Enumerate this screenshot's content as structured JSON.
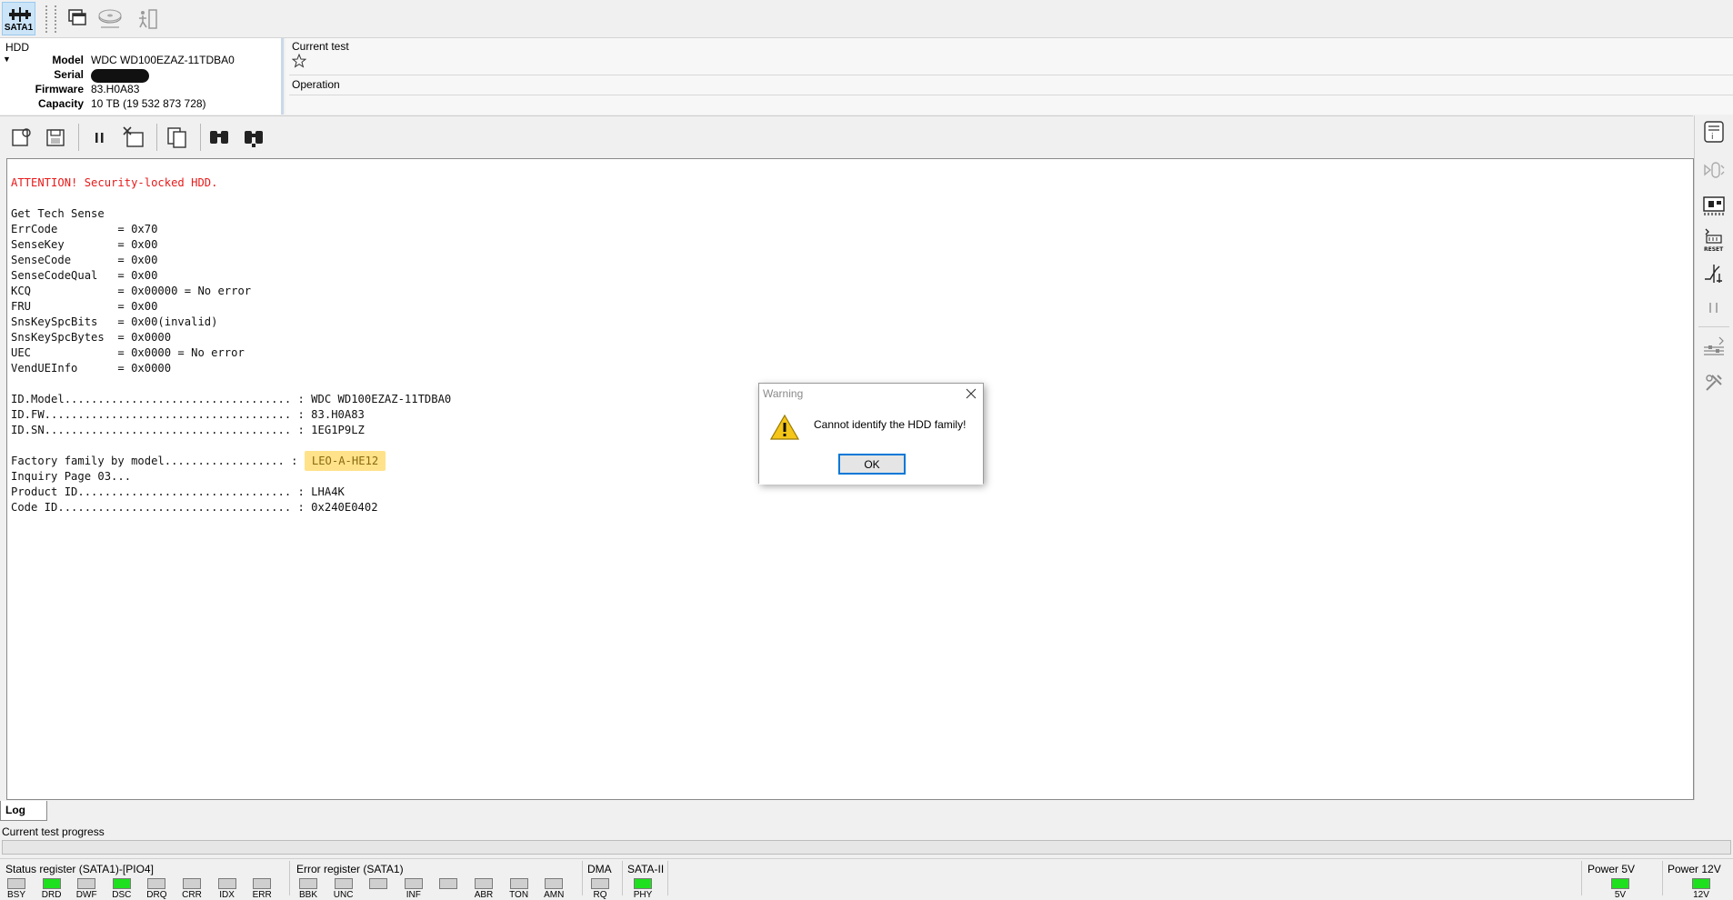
{
  "toolbar": {
    "port_label": "SATA1"
  },
  "hdd": {
    "section_title": "HDD",
    "model_label": "Model",
    "model": "WDC WD100EZAZ-11TDBA0",
    "serial_label": "Serial",
    "firmware_label": "Firmware",
    "firmware": "83.H0A83",
    "capacity_label": "Capacity",
    "capacity": "10 TB (19 532 873 728)"
  },
  "test": {
    "current_test_label": "Current test",
    "operation_label": "Operation"
  },
  "log": {
    "lines": [
      "ATTENTION! Security-locked HDD.",
      "",
      "Get Tech Sense",
      "ErrCode         = 0x70",
      "SenseKey        = 0x00",
      "SenseCode       = 0x00",
      "SenseCodeQual   = 0x00",
      "KCQ             = 0x00000 = No error",
      "FRU             = 0x00",
      "SnsKeySpcBits   = 0x00(invalid)",
      "SnsKeySpcBytes  = 0x0000",
      "UEC             = 0x0000 = No error",
      "VendUEInfo      = 0x0000",
      "",
      "ID.Model.................................. : WDC WD100EZAZ-11TDBA0",
      "ID.FW..................................... : 83.H0A83",
      "ID.SN..................................... : 1EG1P9LZ",
      "",
      "Factory family by model.................. : ",
      "Inquiry Page 03...",
      "Product ID................................ : LHA4K",
      "Code ID................................... : 0x240E0402"
    ],
    "family_value": "LEO-A-HE12"
  },
  "tabs": {
    "log": "Log"
  },
  "progress": {
    "label": "Current test progress",
    "fraction": 0
  },
  "status": {
    "status_register_title": "Status register (SATA1)-[PIO4]",
    "status_leds": [
      {
        "label": "BSY",
        "on": false
      },
      {
        "label": "DRD",
        "on": true
      },
      {
        "label": "DWF",
        "on": false
      },
      {
        "label": "DSC",
        "on": true
      },
      {
        "label": "DRQ",
        "on": false
      },
      {
        "label": "CRR",
        "on": false
      },
      {
        "label": "IDX",
        "on": false
      },
      {
        "label": "ERR",
        "on": false
      }
    ],
    "error_register_title": "Error register (SATA1)",
    "error_leds": [
      {
        "label": "BBK",
        "on": false
      },
      {
        "label": "UNC",
        "on": false
      },
      {
        "label": "",
        "on": false
      },
      {
        "label": "INF",
        "on": false
      },
      {
        "label": "",
        "on": false
      },
      {
        "label": "ABR",
        "on": false
      },
      {
        "label": "TON",
        "on": false
      },
      {
        "label": "AMN",
        "on": false
      }
    ],
    "dma_title": "DMA",
    "dma_led": {
      "label": "RQ",
      "on": false
    },
    "sata_title": "SATA-II",
    "sata_led": {
      "label": "PHY",
      "on": true
    },
    "power5_title": "Power 5V",
    "power5_led": {
      "label": "5V",
      "on": true
    },
    "power12_title": "Power 12V",
    "power12_led": {
      "label": "12V",
      "on": true
    }
  },
  "dialog": {
    "title": "Warning",
    "message": "Cannot identify the HDD family!",
    "ok_label": "OK"
  },
  "colors": {
    "led_on": "#1fe01f",
    "alert_text": "#e81a1a",
    "highlight": "#ffe28a",
    "accent": "#0078d7"
  }
}
